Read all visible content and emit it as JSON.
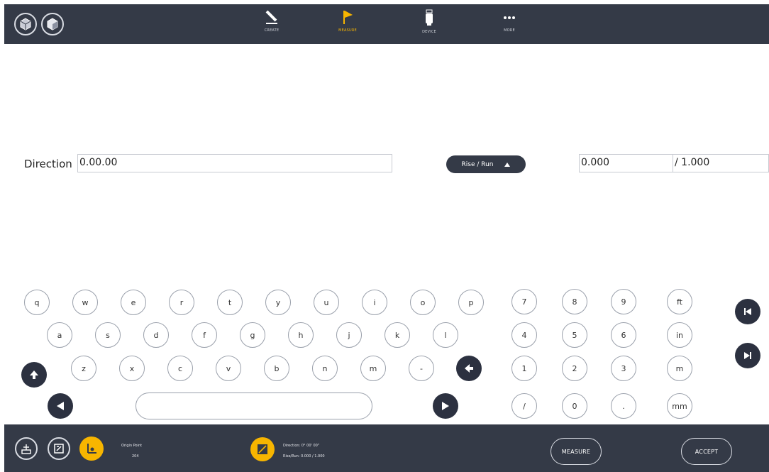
{
  "toolbar": {
    "tools": [
      {
        "label": "CREATE",
        "icon": "pen-icon"
      },
      {
        "label": "MEASURE",
        "icon": "flag-icon",
        "active": true
      },
      {
        "label": "DEVICE",
        "icon": "device-icon"
      },
      {
        "label": "MORE",
        "icon": "more-dots-icon"
      }
    ]
  },
  "form": {
    "direction_label": "Direction",
    "direction_value": "0.00.00",
    "mode_label": "Rise / Run",
    "rise_value": "0.000",
    "run_value": "/ 1.000"
  },
  "keyboard": {
    "row1": [
      "q",
      "w",
      "e",
      "r",
      "t",
      "y",
      "u",
      "i",
      "o",
      "p"
    ],
    "row2": [
      "a",
      "s",
      "d",
      "f",
      "g",
      "h",
      "j",
      "k",
      "l"
    ],
    "row3": [
      "z",
      "x",
      "c",
      "v",
      "b",
      "n",
      "m",
      "-"
    ],
    "numpad": [
      [
        "7",
        "8",
        "9",
        "ft"
      ],
      [
        "4",
        "5",
        "6",
        "in"
      ],
      [
        "1",
        "2",
        "3",
        "m"
      ],
      [
        "/",
        "0",
        ".",
        "mm"
      ]
    ]
  },
  "status": {
    "origin_label": "Origin Point",
    "origin_value": "204",
    "direction_line": "Direction: 0° 00' 00\"",
    "riserun_line": "Rise/Run: 0.000 / 1.000",
    "measure_label": "MEASURE",
    "accept_label": "ACCEPT"
  },
  "colors": {
    "bar": "#343a47",
    "accent": "#f7b500"
  }
}
